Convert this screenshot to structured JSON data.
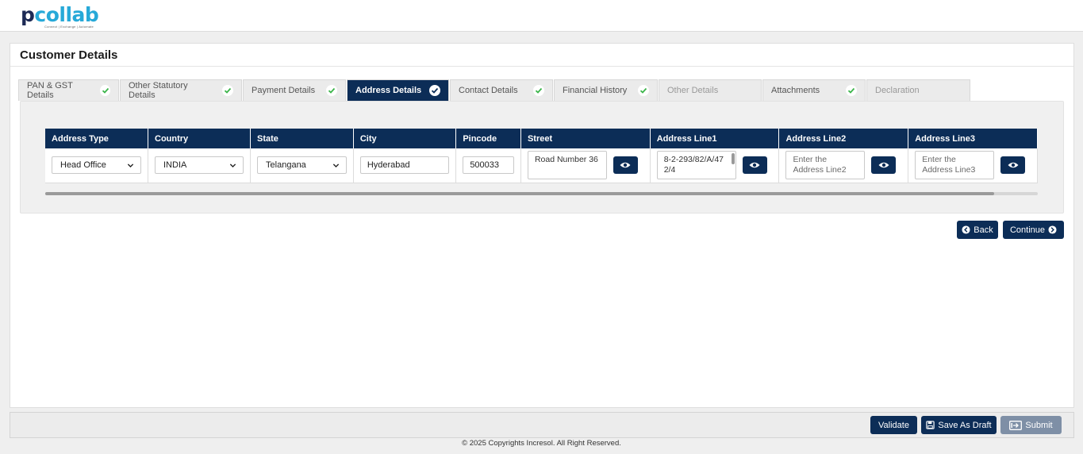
{
  "brand": {
    "logo_p": "p",
    "logo_rest": "collab",
    "tagline": "Connect | Exchange | Automate"
  },
  "page": {
    "title": "Customer Details"
  },
  "tabs": [
    {
      "label": "PAN & GST Details",
      "state": "done"
    },
    {
      "label": "Other Statutory Details",
      "state": "done"
    },
    {
      "label": "Payment Details",
      "state": "done"
    },
    {
      "label": "Address Details",
      "state": "active"
    },
    {
      "label": "Contact Details",
      "state": "done"
    },
    {
      "label": "Financial History",
      "state": "done"
    },
    {
      "label": "Other Details",
      "state": "disabled"
    },
    {
      "label": "Attachments",
      "state": "done"
    },
    {
      "label": "Declaration",
      "state": "disabled"
    }
  ],
  "address_table": {
    "headers": [
      "Address Type",
      "Country",
      "State",
      "City",
      "Pincode",
      "Street",
      "Address Line1",
      "Address Line2",
      "Address Line3"
    ],
    "row": {
      "address_type": "Head Office",
      "country": "INDIA",
      "state": "Telangana",
      "city": "Hyderabad",
      "pincode": "500033",
      "street": "Road Number 36",
      "address_line1": "8-2-293/82/A/472/4",
      "address_line2_placeholder": "Enter the Address Line2",
      "address_line3_placeholder": "Enter the Address Line3"
    }
  },
  "nav": {
    "back_label": "Back",
    "continue_label": "Continue"
  },
  "actions": {
    "validate_label": "Validate",
    "save_draft_label": "Save As Draft",
    "submit_label": "Submit"
  },
  "footer": {
    "copyright": "© 2025 Copyrights Incresol. All Right Reserved."
  },
  "colors": {
    "primary": "#0c2d57",
    "check": "#3bb54a",
    "logo_dark": "#1d2a55",
    "logo_light": "#27a9d8"
  }
}
